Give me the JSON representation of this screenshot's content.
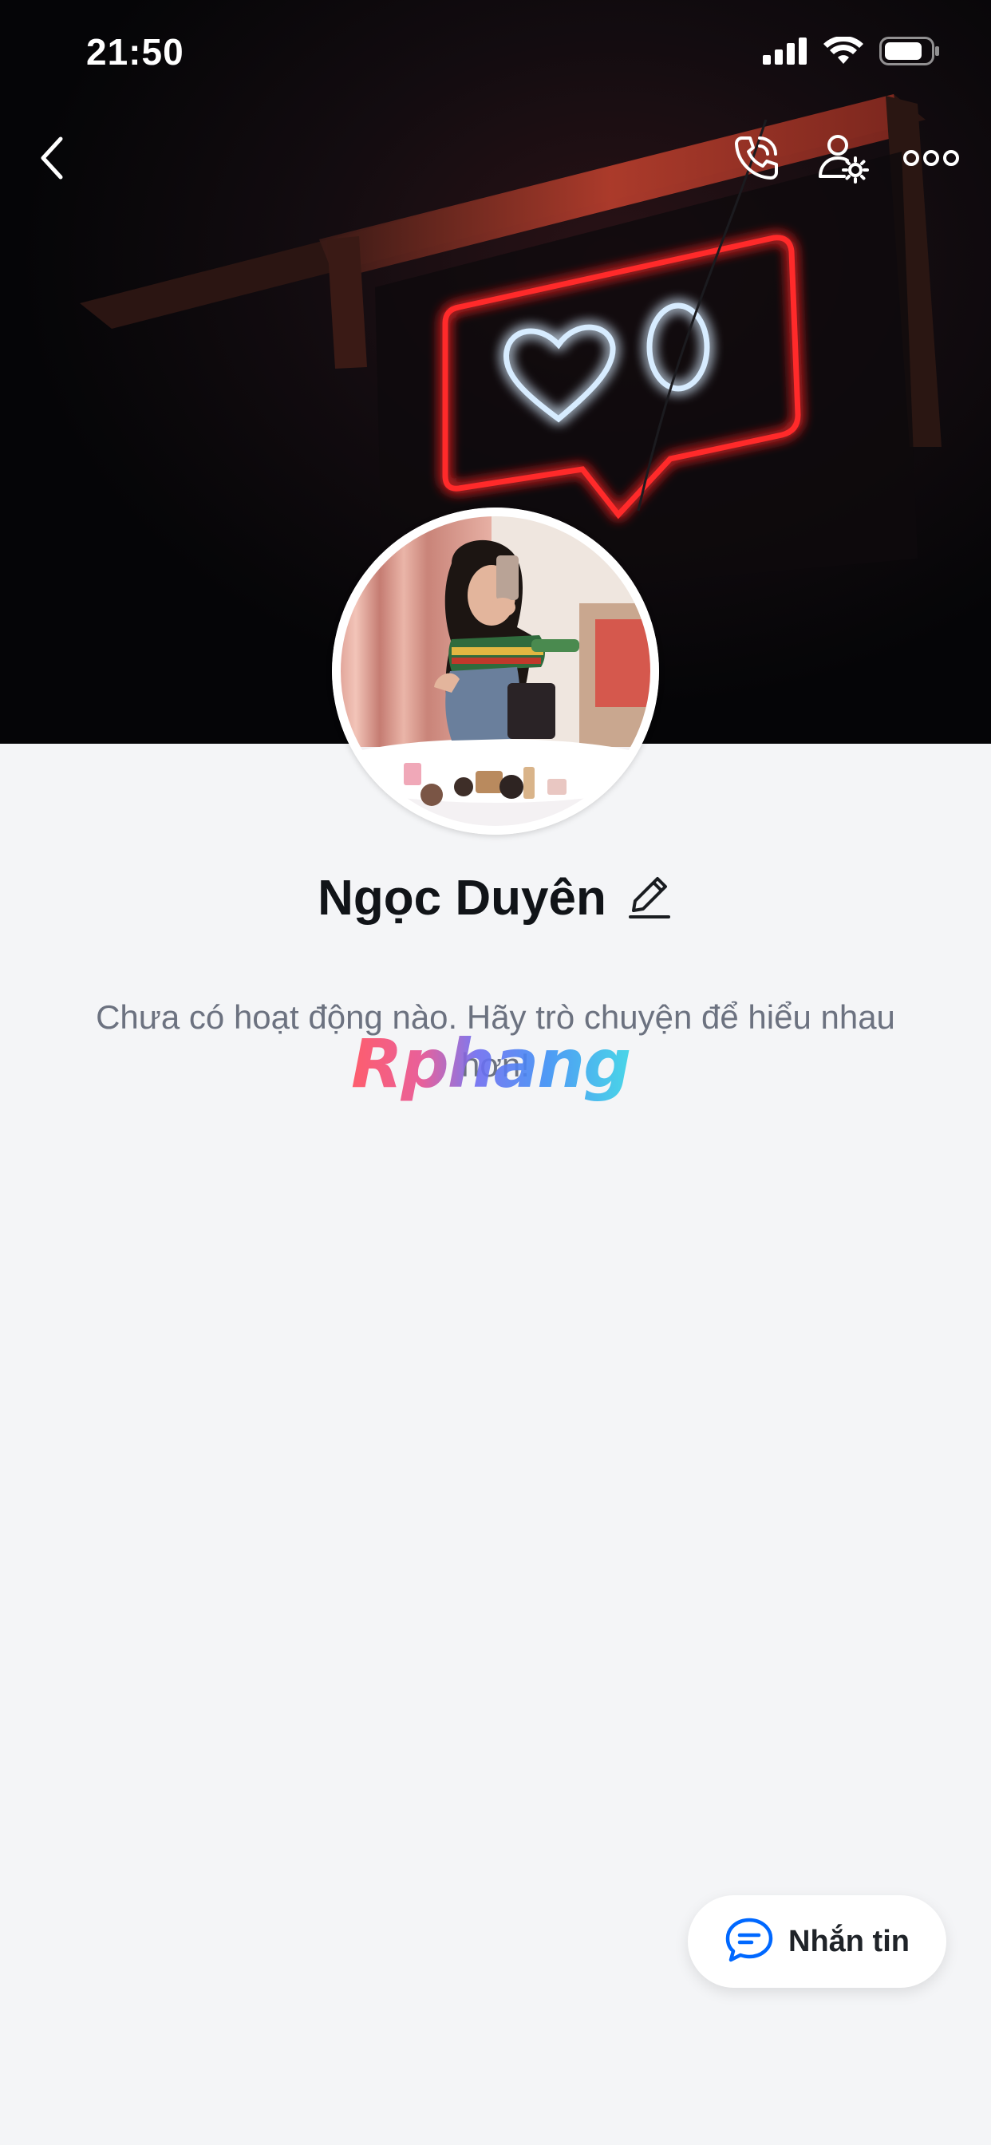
{
  "status_bar": {
    "time": "21:50",
    "icons": [
      "signal-icon",
      "wifi-icon",
      "battery-icon"
    ]
  },
  "header": {
    "back_icon": "chevron-left-icon",
    "actions": [
      "phone-icon",
      "user-settings-icon",
      "more-icon"
    ]
  },
  "profile": {
    "name": "Ngọc Duyên",
    "edit_icon": "pencil-icon"
  },
  "activity": {
    "empty_message": "Chưa có hoạt động nào. Hãy trò chuyện để hiểu nhau hơn!"
  },
  "watermark": {
    "text": "Rphang"
  },
  "message_button": {
    "label": "Nhắn tin",
    "icon": "chat-bubble-icon"
  },
  "colors": {
    "background": "#f4f5f7",
    "accent_blue": "#0068ff",
    "neon_red": "#ff2a2a",
    "neon_white_blue": "#cfe8ff"
  }
}
